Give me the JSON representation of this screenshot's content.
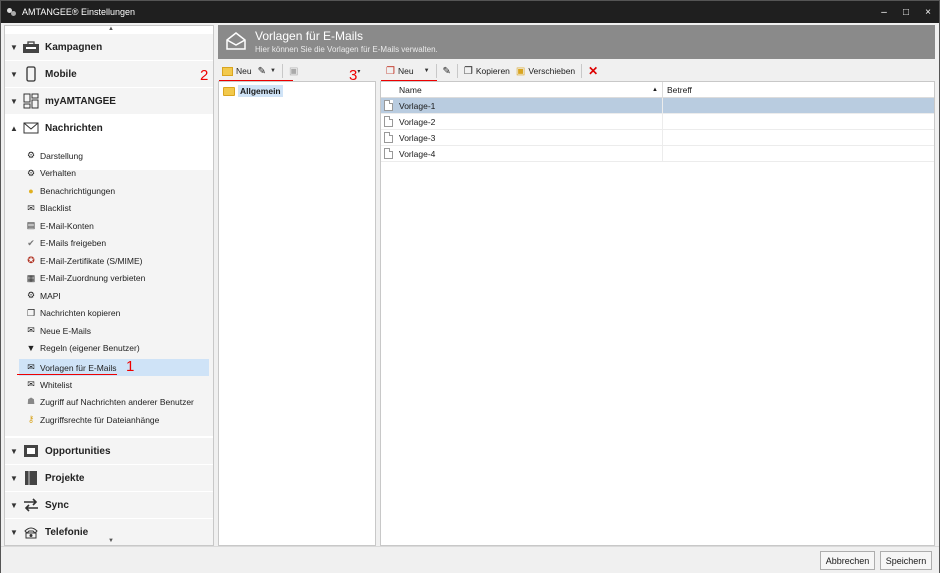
{
  "window": {
    "title": "AMTANGEE® Einstellungen",
    "minimize": "–",
    "maximize": "□",
    "close": "×"
  },
  "sidebar": {
    "scroll_up": "▲",
    "scroll_down": "▼",
    "sections_top": [
      {
        "label": "Kampagnen",
        "arrow": "▼",
        "icon": "briefcase-icon"
      },
      {
        "label": "Mobile",
        "arrow": "▼",
        "icon": "phone-icon"
      },
      {
        "label": "myAMTANGEE",
        "arrow": "▼",
        "icon": "dashboard-icon"
      },
      {
        "label": "Nachrichten",
        "arrow": "▲",
        "icon": "envelope-icon"
      }
    ],
    "sub_items": [
      {
        "label": "Darstellung",
        "icon": "gears-icon"
      },
      {
        "label": "Verhalten",
        "icon": "gears-icon"
      },
      {
        "label": "Benachrichtigungen",
        "icon": "bell-icon"
      },
      {
        "label": "Blacklist",
        "icon": "mail-block-icon"
      },
      {
        "label": "E-Mail-Konten",
        "icon": "accounts-icon"
      },
      {
        "label": "E-Mails freigeben",
        "icon": "check-circle-icon"
      },
      {
        "label": "E-Mail-Zertifikate (S/MIME)",
        "icon": "certificate-icon"
      },
      {
        "label": "E-Mail-Zuordnung verbieten",
        "icon": "assign-block-icon"
      },
      {
        "label": "MAPI",
        "icon": "gears-icon"
      },
      {
        "label": "Nachrichten kopieren",
        "icon": "copy-icon"
      },
      {
        "label": "Neue E-Mails",
        "icon": "new-mail-icon"
      },
      {
        "label": "Regeln (eigener Benutzer)",
        "icon": "filter-icon"
      },
      {
        "label": "Vorlagen für E-Mails",
        "icon": "template-mail-icon"
      },
      {
        "label": "Whitelist",
        "icon": "mail-icon"
      },
      {
        "label": "Zugriff auf Nachrichten anderer Benutzer",
        "icon": "user-icon"
      },
      {
        "label": "Zugriffsrechte für Dateianhänge",
        "icon": "key-icon"
      }
    ],
    "selected_item": "Vorlagen für E-Mails",
    "sections_bottom": [
      {
        "label": "Opportunities",
        "arrow": "▼",
        "icon": "opportunities-icon"
      },
      {
        "label": "Projekte",
        "arrow": "▼",
        "icon": "project-icon"
      },
      {
        "label": "Sync",
        "arrow": "▼",
        "icon": "sync-icon"
      },
      {
        "label": "Telefonie",
        "arrow": "▼",
        "icon": "telephone-icon"
      }
    ]
  },
  "header": {
    "title": "Vorlagen für E-Mails",
    "subtitle": "Hier können Sie die Vorlagen für E-Mails verwalten."
  },
  "folder_toolbar": {
    "new_label": "Neu"
  },
  "list_toolbar": {
    "new_label": "Neu",
    "copy_label": "Kopieren",
    "move_label": "Verschieben"
  },
  "folders": [
    {
      "label": "Allgemein",
      "selected": true
    }
  ],
  "list": {
    "columns": [
      "Name",
      "Betreff"
    ],
    "sort_indicator": "▲",
    "rows": [
      {
        "name": "Vorlage-1",
        "subject": "",
        "selected": true
      },
      {
        "name": "Vorlage-2",
        "subject": ""
      },
      {
        "name": "Vorlage-3",
        "subject": ""
      },
      {
        "name": "Vorlage-4",
        "subject": ""
      }
    ]
  },
  "annotations": [
    "1",
    "2",
    "3"
  ],
  "footer": {
    "cancel": "Abbrechen",
    "save": "Speichern"
  },
  "colors": {
    "accent_red": "#e00000",
    "header_gray": "#8a8a8a",
    "selection": "#b9cce0"
  }
}
